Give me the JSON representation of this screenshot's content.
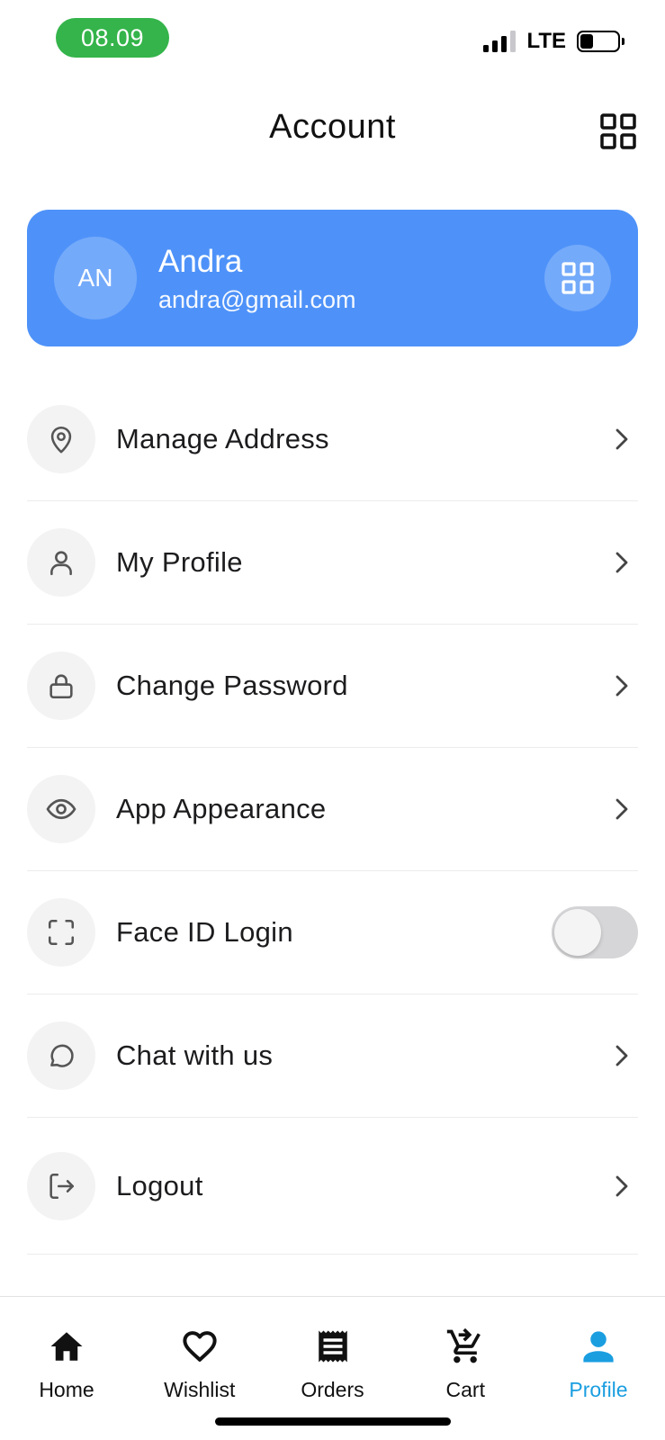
{
  "status_bar": {
    "time": "08.09",
    "network": "LTE",
    "battery_level": 0.25,
    "signal_bars": 3
  },
  "header": {
    "title": "Account",
    "menu_icon": "grid-icon"
  },
  "profile": {
    "initials": "AN",
    "name": "Andra",
    "email": "andra@gmail.com",
    "qr_icon": "qr-grid-icon",
    "card_color": "#4e92f9"
  },
  "menu": {
    "items": [
      {
        "label": "Manage Address",
        "icon": "location-pin-icon"
      },
      {
        "label": "My Profile",
        "icon": "user-icon"
      },
      {
        "label": "Change Password",
        "icon": "lock-icon"
      },
      {
        "label": "App Appearance",
        "icon": "eye-icon"
      },
      {
        "label": "Face ID Login",
        "icon": "face-id-icon",
        "toggle": false
      },
      {
        "label": "Chat with us",
        "icon": "chat-bubble-icon"
      },
      {
        "label": "Logout",
        "icon": "logout-icon"
      }
    ]
  },
  "bottom_nav": {
    "active_color": "#1a9ee0",
    "items": [
      {
        "label": "Home",
        "icon": "home-icon"
      },
      {
        "label": "Wishlist",
        "icon": "heart-icon"
      },
      {
        "label": "Orders",
        "icon": "receipt-icon"
      },
      {
        "label": "Cart",
        "icon": "cart-icon"
      },
      {
        "label": "Profile",
        "icon": "profile-icon",
        "active": true
      }
    ]
  }
}
